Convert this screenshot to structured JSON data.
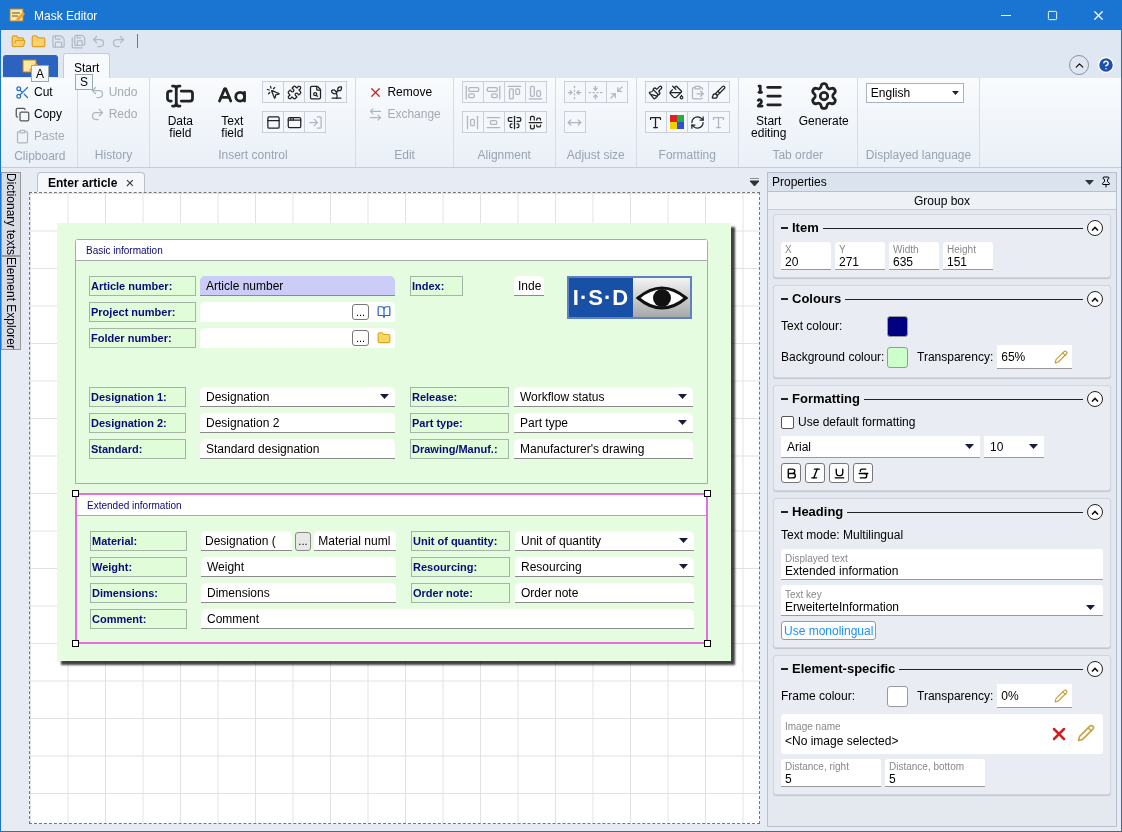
{
  "window": {
    "title": "Mask Editor"
  },
  "quick_access": [
    {
      "disabled": false
    },
    {
      "disabled": false
    },
    {
      "disabled": true
    },
    {
      "disabled": true
    },
    {
      "disabled": true
    },
    {
      "disabled": true
    }
  ],
  "app_button": {
    "key_tip": "A"
  },
  "tabs": [
    {
      "label": "Start",
      "selected": true,
      "key_tip": "S"
    }
  ],
  "ribbon_groups": [
    {
      "label": "Clipboard",
      "items": [
        {
          "kind": "small",
          "label": "Cut",
          "disabled": false
        },
        {
          "kind": "small",
          "label": "Copy",
          "disabled": false
        },
        {
          "kind": "small",
          "label": "Paste",
          "disabled": true
        }
      ]
    },
    {
      "label": "History",
      "items": [
        {
          "kind": "small",
          "label": "Undo",
          "disabled": true
        },
        {
          "kind": "small",
          "label": "Redo",
          "disabled": true
        }
      ]
    },
    {
      "label": "Insert control",
      "items": [
        {
          "kind": "large",
          "label": "Data field",
          "disabled": false
        },
        {
          "kind": "large",
          "label": "Text field",
          "disabled": false
        },
        {
          "kind": "icon_rows",
          "rows": [
            [
              {
                "disabled": false
              },
              {
                "disabled": false
              },
              {
                "disabled": false
              },
              {
                "disabled": false
              }
            ],
            [
              {
                "disabled": false
              },
              {
                "disabled": false
              },
              {
                "disabled": true
              }
            ]
          ]
        }
      ]
    },
    {
      "label": "Edit",
      "items": [
        {
          "kind": "small",
          "label": "Remove",
          "disabled": false
        },
        {
          "kind": "small",
          "label": "Exchange",
          "disabled": true
        }
      ]
    },
    {
      "label": "Alignment",
      "items": [
        {
          "kind": "icon_rows",
          "rows": [
            [
              {
                "disabled": true
              },
              {
                "disabled": true
              },
              {
                "disabled": true
              },
              {
                "disabled": true
              }
            ],
            [
              {
                "disabled": true
              },
              {
                "disabled": true
              },
              {
                "disabled": false
              },
              {
                "disabled": false
              }
            ]
          ]
        }
      ]
    },
    {
      "label": "Adjust size",
      "items": [
        {
          "kind": "icon_rows",
          "rows": [
            [
              {
                "disabled": true
              },
              {
                "disabled": true
              },
              {
                "disabled": true
              }
            ],
            [
              {
                "disabled": true
              }
            ]
          ]
        }
      ]
    },
    {
      "label": "Formatting",
      "items": [
        {
          "kind": "icon_rows",
          "rows": [
            [
              {
                "disabled": false
              },
              {
                "disabled": false
              },
              {
                "disabled": true
              },
              {
                "disabled": false
              }
            ],
            [
              {
                "disabled": false
              },
              {
                "disabled": false
              },
              {
                "disabled": false
              },
              {
                "disabled": true
              }
            ]
          ]
        }
      ]
    },
    {
      "label": "Tab order",
      "items": [
        {
          "kind": "large",
          "label": "Start editing",
          "disabled": false
        },
        {
          "kind": "large",
          "label": "Generate",
          "disabled": false
        }
      ]
    },
    {
      "label": "Displayed language",
      "items": [
        {
          "kind": "dropdown",
          "value": "English"
        }
      ]
    }
  ],
  "side_tabs": [
    {
      "label": "Dictionary texts"
    },
    {
      "label": "Element Explorer"
    }
  ],
  "document_tab": {
    "label": "Enter article",
    "close": "×"
  },
  "form": {
    "groups": [
      {
        "title": "Basic information",
        "selected": false,
        "logo": {
          "text": "I·S·D"
        },
        "sections": [
          {
            "rows": [
              {
                "left": {
                  "label": "Article number:",
                  "field": {
                    "kind": "text",
                    "value": "Article number",
                    "focused": true
                  }
                },
                "right": {
                  "label": "Index:",
                  "field": {
                    "kind": "text",
                    "value": "Inde",
                    "focused": false
                  }
                }
              },
              {
                "left": {
                  "label": "Project number:",
                  "field": {
                    "kind": "lookup",
                    "button": "..."
                  }
                }
              },
              {
                "left": {
                  "label": "Folder number:",
                  "field": {
                    "kind": "lookup",
                    "button": "..."
                  }
                }
              }
            ]
          },
          {
            "rows": [
              {
                "left": {
                  "label": "Designation 1:",
                  "field": {
                    "kind": "combo",
                    "value": "Designation"
                  }
                },
                "right": {
                  "label": "Release:",
                  "field": {
                    "kind": "combo",
                    "value": "Workflow status"
                  }
                }
              },
              {
                "left": {
                  "label": "Designation 2:",
                  "field": {
                    "kind": "text",
                    "value": "Designation 2",
                    "focused": false
                  }
                },
                "right": {
                  "label": "Part type:",
                  "field": {
                    "kind": "combo",
                    "value": "Part type"
                  }
                }
              },
              {
                "left": {
                  "label": "Standard:",
                  "field": {
                    "kind": "text",
                    "value": "Standard designation",
                    "focused": false
                  }
                },
                "right": {
                  "label": "Drawing/Manuf.:",
                  "field": {
                    "kind": "text",
                    "value": "Manufacturer's drawing",
                    "focused": false
                  }
                }
              }
            ]
          }
        ]
      },
      {
        "title": "Extended information",
        "selected": true,
        "sections": [
          {
            "rows": [
              {
                "left": {
                  "label": "Material:",
                  "field": {
                    "kind": "split",
                    "values": [
                      "Designation (",
                      "Material numl"
                    ],
                    "button": "..."
                  }
                },
                "right": {
                  "label": "Unit of quantity:",
                  "field": {
                    "kind": "combo",
                    "value": "Unit of quantity"
                  }
                }
              },
              {
                "left": {
                  "label": "Weight:",
                  "field": {
                    "kind": "text",
                    "value": "Weight",
                    "focused": false
                  }
                },
                "right": {
                  "label": "Resourcing:",
                  "field": {
                    "kind": "combo",
                    "value": "Resourcing"
                  }
                }
              },
              {
                "left": {
                  "label": "Dimensions:",
                  "field": {
                    "kind": "text",
                    "value": "Dimensions",
                    "focused": false
                  }
                },
                "right": {
                  "label": "Order note:",
                  "field": {
                    "kind": "text",
                    "value": "Order note",
                    "focused": false
                  }
                }
              },
              {
                "left": {
                  "label": "Comment:",
                  "field": {
                    "kind": "text",
                    "value": "Comment",
                    "focused": false
                  }
                }
              }
            ]
          }
        ]
      }
    ]
  },
  "properties": {
    "title": "Properties",
    "element_type": "Group box",
    "sections": [
      {
        "title": "Item",
        "expanded": true,
        "rows": [
          {
            "kind": "fields",
            "fields": [
              {
                "label": "X",
                "value": "20"
              },
              {
                "label": "Y",
                "value": "271"
              },
              {
                "label": "Width",
                "value": "635"
              },
              {
                "label": "Height",
                "value": "151"
              }
            ]
          }
        ]
      },
      {
        "title": "Colours",
        "expanded": true,
        "rows": [
          {
            "kind": "swatch",
            "label": "Text colour:",
            "color": "#000080"
          },
          {
            "kind": "swatch",
            "label": "Background colour:",
            "color": "#ccffcc",
            "transparency_label": "Transparency:",
            "transparency": "65%"
          }
        ]
      },
      {
        "title": "Formatting",
        "expanded": true,
        "rows": [
          {
            "kind": "checkbox",
            "label": "Use default formatting",
            "checked": false
          },
          {
            "kind": "font",
            "font": "Arial",
            "size": "10"
          },
          {
            "kind": "styles"
          }
        ]
      },
      {
        "title": "Heading",
        "expanded": true,
        "rows": [
          {
            "kind": "text",
            "text": "Text mode: Multilingual"
          },
          {
            "kind": "labeled_field",
            "label": "Displayed text",
            "value": "Extended information"
          },
          {
            "kind": "labeled_combo",
            "label": "Text key",
            "value": "ErweiterteInformation"
          },
          {
            "kind": "link_button",
            "label": "Use monolingual"
          }
        ]
      },
      {
        "title": "Element-specific",
        "expanded": true,
        "rows": [
          {
            "kind": "swatch",
            "label": "Frame colour:",
            "color": "#ffffff",
            "transparency_label": "Transparency:",
            "transparency": "0%"
          },
          {
            "kind": "image",
            "label": "Image name",
            "value": "<No image selected>"
          },
          {
            "kind": "fields",
            "fields": [
              {
                "label": "Distance, right",
                "value": "5"
              },
              {
                "label": "Distance, bottom",
                "value": "5"
              }
            ]
          }
        ]
      }
    ]
  }
}
